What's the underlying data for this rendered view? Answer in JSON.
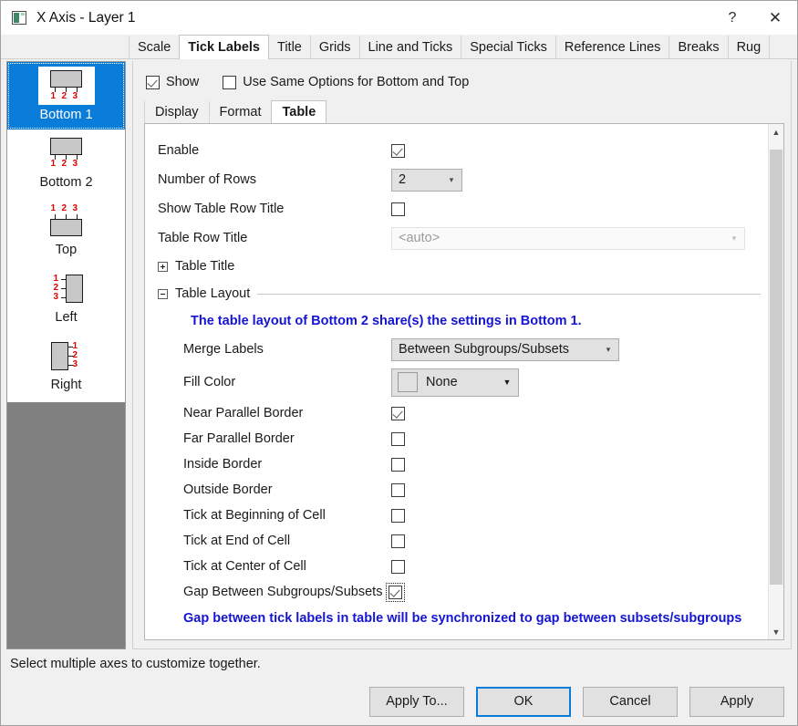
{
  "window": {
    "title": "X Axis - Layer 1",
    "icon": "axis-dialog-icon",
    "help_label": "?",
    "close_label": "✕"
  },
  "tabs": [
    {
      "label": "Scale",
      "active": false
    },
    {
      "label": "Tick Labels",
      "active": true
    },
    {
      "label": "Title",
      "active": false
    },
    {
      "label": "Grids",
      "active": false
    },
    {
      "label": "Line and Ticks",
      "active": false
    },
    {
      "label": "Special Ticks",
      "active": false
    },
    {
      "label": "Reference Lines",
      "active": false
    },
    {
      "label": "Breaks",
      "active": false
    },
    {
      "label": "Rug",
      "active": false
    }
  ],
  "axis_list": {
    "items": [
      {
        "label": "Bottom 1",
        "glyph": "axis-bottom-glyph",
        "selected": true
      },
      {
        "label": "Bottom 2",
        "glyph": "axis-bottom-glyph",
        "selected": false
      },
      {
        "label": "Top",
        "glyph": "axis-top-glyph",
        "selected": false
      },
      {
        "label": "Left",
        "glyph": "axis-left-glyph",
        "selected": false
      },
      {
        "label": "Right",
        "glyph": "axis-right-glyph",
        "selected": false
      }
    ],
    "tick_numbers": [
      "1",
      "2",
      "3"
    ]
  },
  "top_options": {
    "show": {
      "label": "Show",
      "checked": true
    },
    "same_options": {
      "label": "Use Same Options for Bottom and Top",
      "checked": false
    }
  },
  "inner_tabs": [
    {
      "label": "Display",
      "active": false
    },
    {
      "label": "Format",
      "active": false
    },
    {
      "label": "Table",
      "active": true
    }
  ],
  "table_tab": {
    "enable": {
      "label": "Enable",
      "checked": true
    },
    "number_of_rows": {
      "label": "Number of Rows",
      "value": "2"
    },
    "show_table_row_title": {
      "label": "Show Table Row Title",
      "checked": false
    },
    "table_row_title": {
      "label": "Table Row Title",
      "value": "<auto>",
      "disabled": true
    },
    "table_title_group": {
      "label": "Table Title",
      "expanded": false
    },
    "table_layout_group": {
      "label": "Table Layout",
      "expanded": true
    },
    "share_note": "The table layout of Bottom 2 share(s) the settings in Bottom 1.",
    "merge_labels": {
      "label": "Merge Labels",
      "value": "Between Subgroups/Subsets"
    },
    "fill_color": {
      "label": "Fill Color",
      "value": "None",
      "swatch": "#e1e1e1"
    },
    "checkboxes": [
      {
        "label": "Near Parallel Border",
        "checked": true,
        "focused": false
      },
      {
        "label": "Far Parallel Border",
        "checked": false,
        "focused": false
      },
      {
        "label": "Inside Border",
        "checked": false,
        "focused": false
      },
      {
        "label": "Outside Border",
        "checked": false,
        "focused": false
      },
      {
        "label": "Tick at Beginning of Cell",
        "checked": false,
        "focused": false
      },
      {
        "label": "Tick at End of Cell",
        "checked": false,
        "focused": false
      },
      {
        "label": "Tick at Center of Cell",
        "checked": false,
        "focused": false
      },
      {
        "label": "Gap Between Subgroups/Subsets",
        "checked": true,
        "focused": true
      }
    ],
    "gap_note": "Gap between tick labels in table will be synchronized to gap between subsets/subgroups"
  },
  "scrollbar": {
    "up_arrow": "⌃",
    "down_arrow": "⌄"
  },
  "status": {
    "text": "Select multiple axes to customize together."
  },
  "buttons": [
    {
      "label": "Apply To...",
      "default": false
    },
    {
      "label": "OK",
      "default": true
    },
    {
      "label": "Cancel",
      "default": false
    },
    {
      "label": "Apply",
      "default": false
    }
  ],
  "colors": {
    "accent": "#0a7ddb",
    "note": "#1414d2",
    "tick_red": "#e00000"
  }
}
